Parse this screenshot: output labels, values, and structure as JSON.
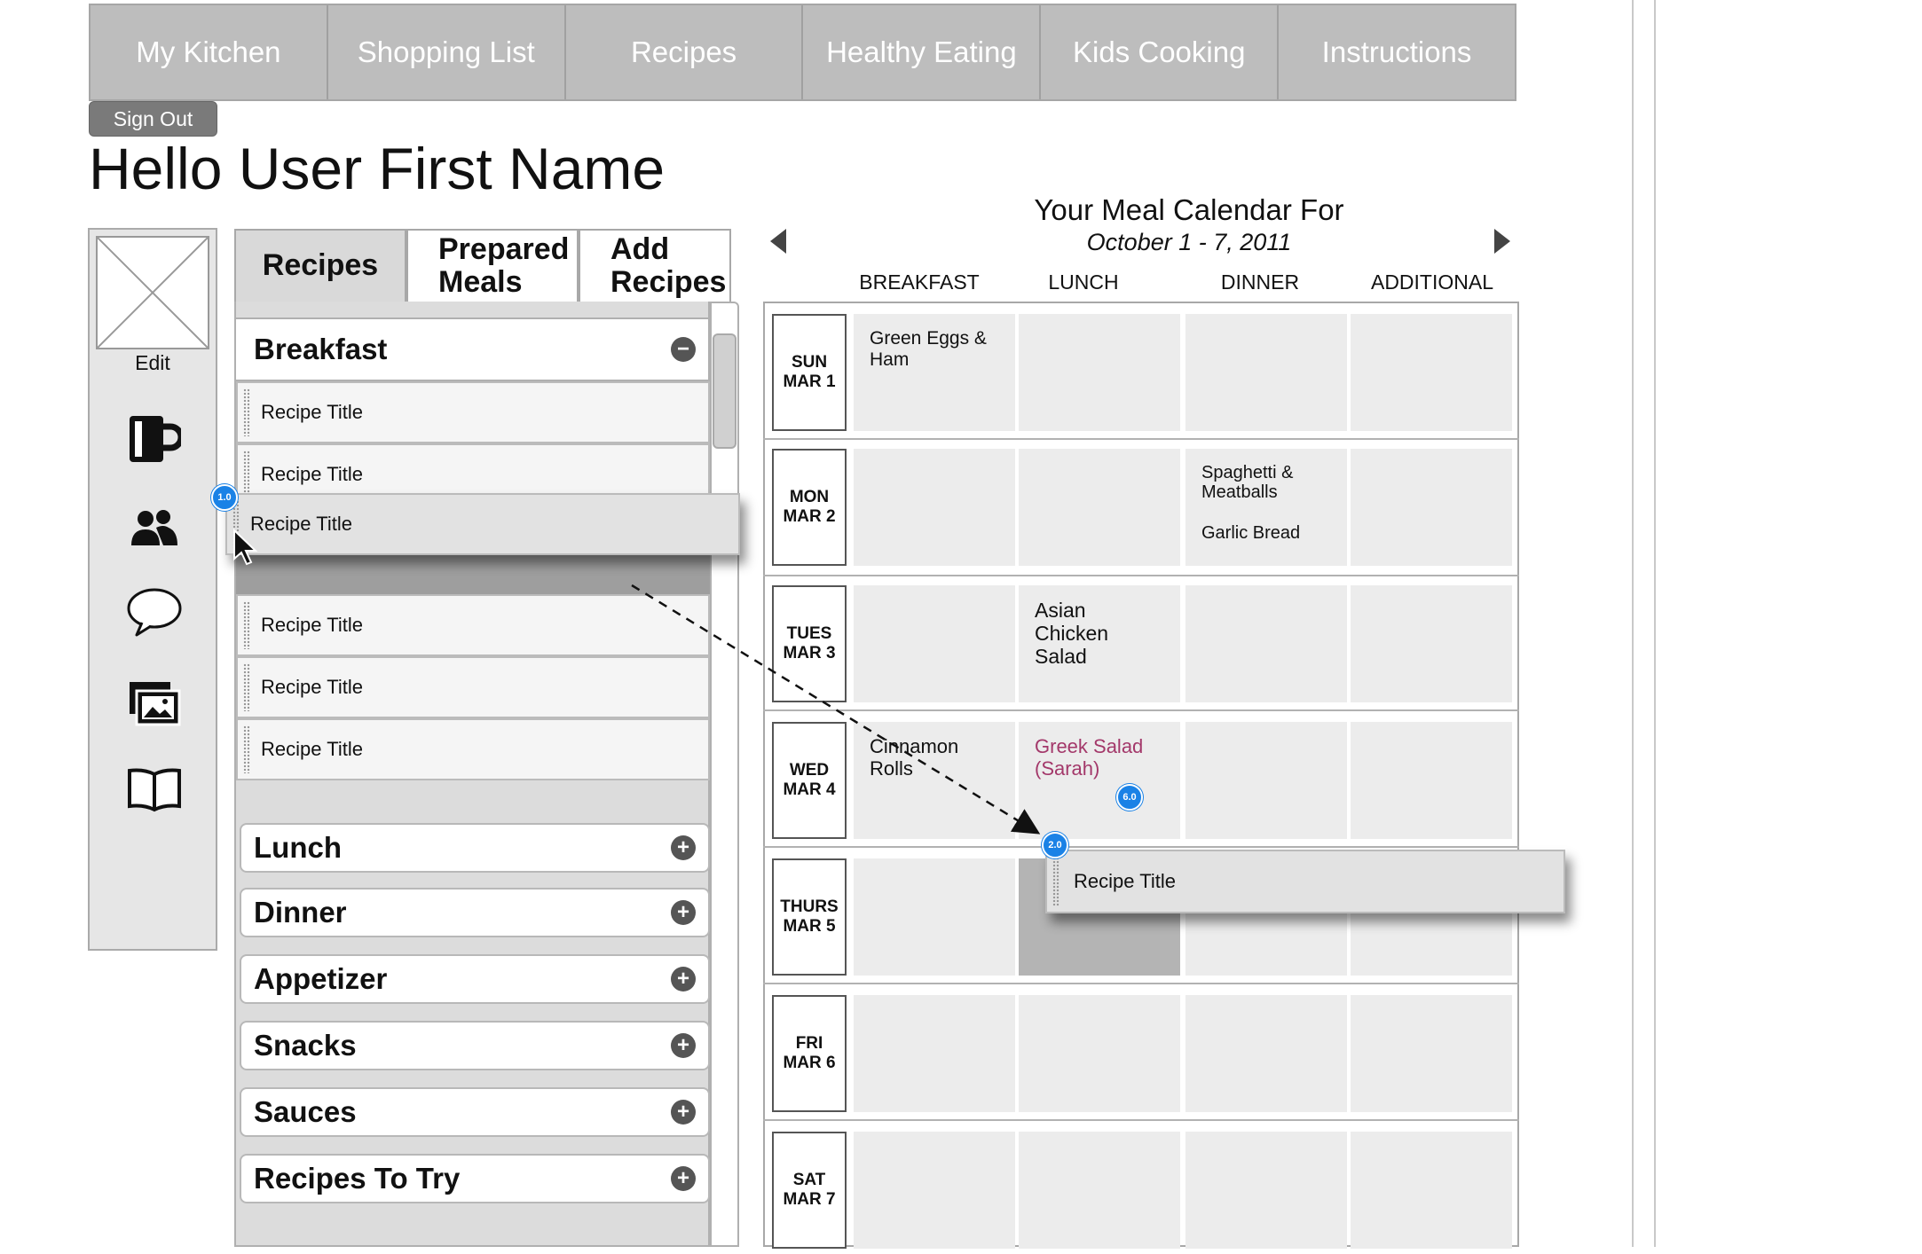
{
  "nav": {
    "items": [
      "My Kitchen",
      "Shopping List",
      "Recipes",
      "Healthy Eating",
      "Kids Cooking",
      "Instructions"
    ]
  },
  "header": {
    "sign_out": "Sign Out",
    "greeting": "Hello User First Name"
  },
  "sidebar": {
    "edit_label": "Edit",
    "icons": [
      "mug-icon",
      "people-icon",
      "speech-bubble-icon",
      "photos-icon",
      "book-icon"
    ]
  },
  "tabs": {
    "recipes": "Recipes",
    "prepared_meals": "Prepared Meals",
    "add_recipes": "Add Recipes"
  },
  "recipes_panel": {
    "open_category": "Breakfast",
    "recipe_rows": [
      "Recipe Title",
      "Recipe Title",
      "Recipe Title",
      "Recipe Title",
      "Recipe Title"
    ],
    "dragging_item": "Recipe Title",
    "categories": [
      "Lunch",
      "Dinner",
      "Appetizer",
      "Snacks",
      "Sauces",
      "Recipes To Try"
    ],
    "collapse_symbol": "−",
    "expand_symbol": "+"
  },
  "calendar": {
    "title": "Your Meal Calendar For",
    "date_range": "October 1 - 7, 2011",
    "columns": [
      "BREAKFAST",
      "LUNCH",
      "DINNER",
      "ADDITIONAL"
    ],
    "days": [
      {
        "day": "SUN",
        "date": "MAR 1",
        "breakfast": "Green Eggs & Ham",
        "lunch": "",
        "dinner": "",
        "additional": ""
      },
      {
        "day": "MON",
        "date": "MAR 2",
        "breakfast": "",
        "lunch": "",
        "dinner": "Spaghetti & Meatballs",
        "dinner_extra": "Garlic Bread",
        "additional": ""
      },
      {
        "day": "TUES",
        "date": "MAR 3",
        "breakfast": "",
        "lunch": "Asian Chicken Salad",
        "dinner": "",
        "additional": ""
      },
      {
        "day": "WED",
        "date": "MAR 4",
        "breakfast": "Cinnamon Rolls",
        "lunch": "Greek Salad (Sarah)",
        "dinner": "",
        "additional": ""
      },
      {
        "day": "THURS",
        "date": "MAR 5",
        "breakfast": "",
        "lunch": "",
        "dinner": "",
        "additional": ""
      },
      {
        "day": "FRI",
        "date": "MAR 6",
        "breakfast": "",
        "lunch": "",
        "dinner": "",
        "additional": ""
      },
      {
        "day": "SAT",
        "date": "MAR 7",
        "breakfast": "",
        "lunch": "",
        "dinner": "",
        "additional": ""
      }
    ],
    "drop_item": "Recipe Title"
  },
  "annotations": {
    "badge_1": "1.0",
    "badge_2": "2.0",
    "badge_6": "6.0"
  },
  "colors": {
    "nav_bg": "#bdbdbd",
    "badge_blue": "#1a82e6",
    "highlight_pink": "#a3386a"
  }
}
